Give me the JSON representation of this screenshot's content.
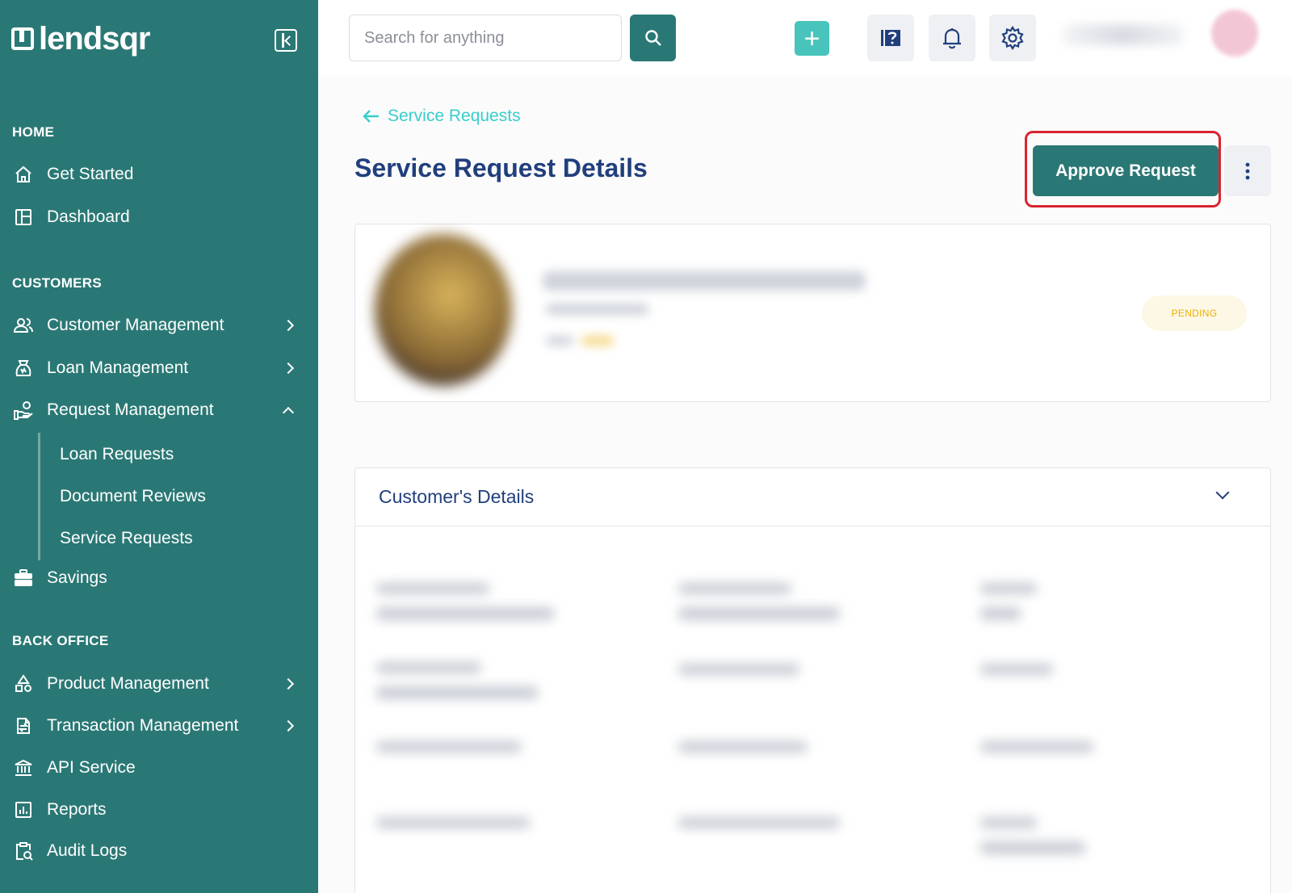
{
  "brand": {
    "name": "lendsqr"
  },
  "sidebar": {
    "sections": [
      {
        "title": "HOME"
      },
      {
        "title": "CUSTOMERS"
      },
      {
        "title": "BACK OFFICE"
      }
    ],
    "items": {
      "get_started": "Get Started",
      "dashboard": "Dashboard",
      "customer_management": "Customer Management",
      "loan_management": "Loan Management",
      "request_management": "Request Management",
      "loan_requests": "Loan Requests",
      "document_reviews": "Document Reviews",
      "service_requests": "Service Requests",
      "savings": "Savings",
      "product_management": "Product Management",
      "transaction_management": "Transaction Management",
      "api_service": "API Service",
      "reports": "Reports",
      "audit_logs": "Audit Logs"
    }
  },
  "topbar": {
    "search_placeholder": "Search for anything",
    "plus_symbol": "+"
  },
  "main": {
    "back_label": "Service Requests",
    "title": "Service Request Details",
    "approve_label": "Approve Request",
    "status_badge": "PENDING",
    "details_title": "Customer's Details"
  },
  "colors": {
    "sidebar_bg": "#2a7875",
    "accent_teal": "#39cdcc",
    "primary_text": "#213f7d",
    "highlight_red": "#d9252f",
    "pending": "#e9b200"
  }
}
